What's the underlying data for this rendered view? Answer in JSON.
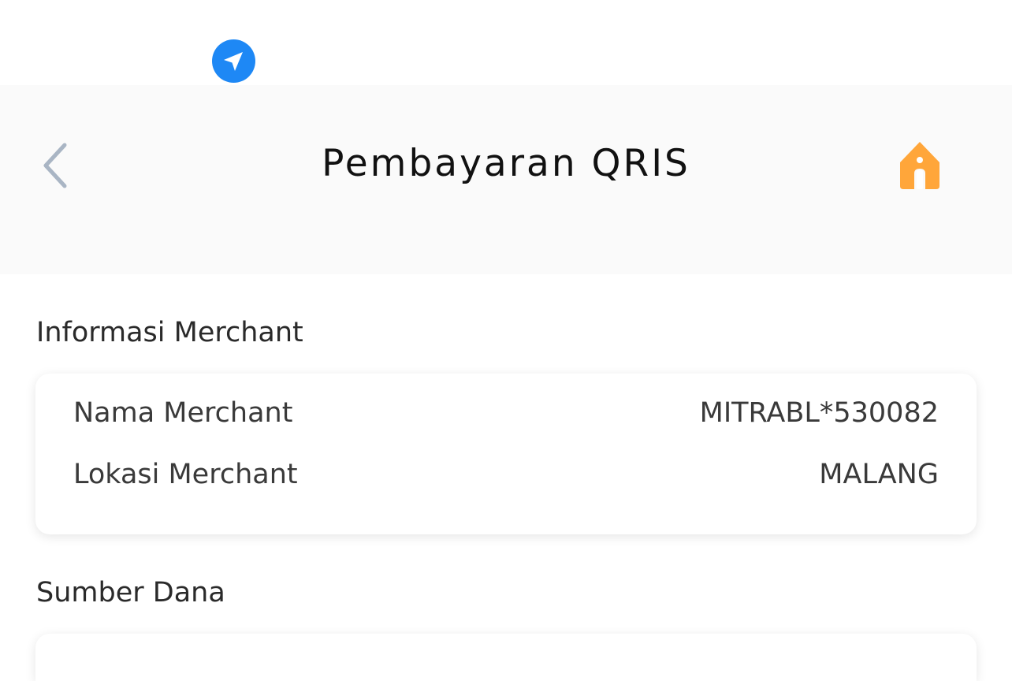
{
  "status_bar": {
    "location_icon": "navigation-arrow-icon",
    "location_icon_color": "#1e88f5"
  },
  "header": {
    "title": "Pembayaran QRIS",
    "back_icon": "chevron-left-icon",
    "home_icon": "home-icon",
    "home_icon_color": "#ffa63a",
    "back_icon_color": "#a9b5c4"
  },
  "merchant_section": {
    "title": "Informasi Merchant",
    "rows": [
      {
        "label": "Nama Merchant",
        "value": "MITRABL*530082"
      },
      {
        "label": "Lokasi Merchant",
        "value": "MALANG"
      }
    ]
  },
  "funds_section": {
    "title": "Sumber Dana"
  }
}
